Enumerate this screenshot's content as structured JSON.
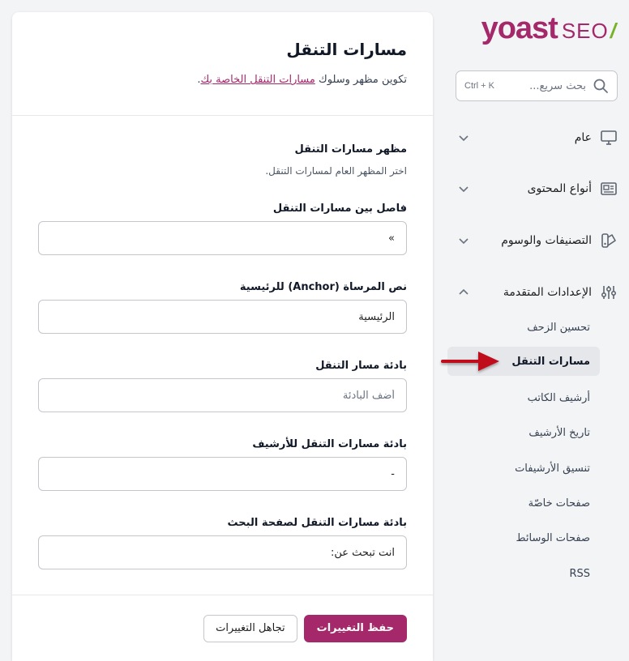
{
  "logo": {
    "brand": "yoast",
    "suffix": "SEO",
    "slash": "/"
  },
  "search": {
    "placeholder": "بحث سريع...",
    "shortcut": "Ctrl + K"
  },
  "sidebar": {
    "groups": [
      {
        "label": "عام",
        "icon": "desktop-icon",
        "expanded": false
      },
      {
        "label": "أنواع المحتوى",
        "icon": "newspaper-icon",
        "expanded": false
      },
      {
        "label": "التصنيفات والوسوم",
        "icon": "color-swatch-icon",
        "expanded": false
      },
      {
        "label": "الإعدادات المتقدمة",
        "icon": "adjustments-icon",
        "expanded": true
      }
    ],
    "sub_items": [
      {
        "label": "تحسين الزحف",
        "active": false
      },
      {
        "label": "مسارات التنقل",
        "active": true
      },
      {
        "label": "أرشيف الكاتب",
        "active": false
      },
      {
        "label": "تاريخ الأرشيف",
        "active": false
      },
      {
        "label": "تنسيق الأرشيفات",
        "active": false
      },
      {
        "label": "صفحات خاصّة",
        "active": false
      },
      {
        "label": "صفحات الوسائط",
        "active": false
      },
      {
        "label": "RSS",
        "active": false
      }
    ]
  },
  "main": {
    "title": "مسارات التنقل",
    "description_prefix": "تكوين مظهر وسلوك ",
    "description_link": "مسارات التنقل الخاصة بك",
    "description_suffix": ".",
    "section": {
      "title": "مظهر مسارات التنقل",
      "description": "اختر المظهر العام لمسارات التنقل."
    },
    "fields": [
      {
        "label": "فاصل بين مسارات التنقل",
        "value": "»",
        "placeholder": ""
      },
      {
        "label": "نص المرساة (Anchor) للرئيسية",
        "value": "الرئيسية",
        "placeholder": ""
      },
      {
        "label": "بادئة مسار التنقل",
        "value": "",
        "placeholder": "أضف البادئة"
      },
      {
        "label": "بادئة مسارات التنقل للأرشيف",
        "value": "-",
        "placeholder": ""
      },
      {
        "label": "بادئة مسارات التنقل لصفحة البحث",
        "value": "انت تبحث عن:",
        "placeholder": ""
      }
    ]
  },
  "footer": {
    "save_label": "حفظ التغييرات",
    "discard_label": "تجاهل التغييرات"
  },
  "colors": {
    "brand": "#a4286a",
    "accent_green": "#77b227",
    "arrow": "#c0111f"
  }
}
